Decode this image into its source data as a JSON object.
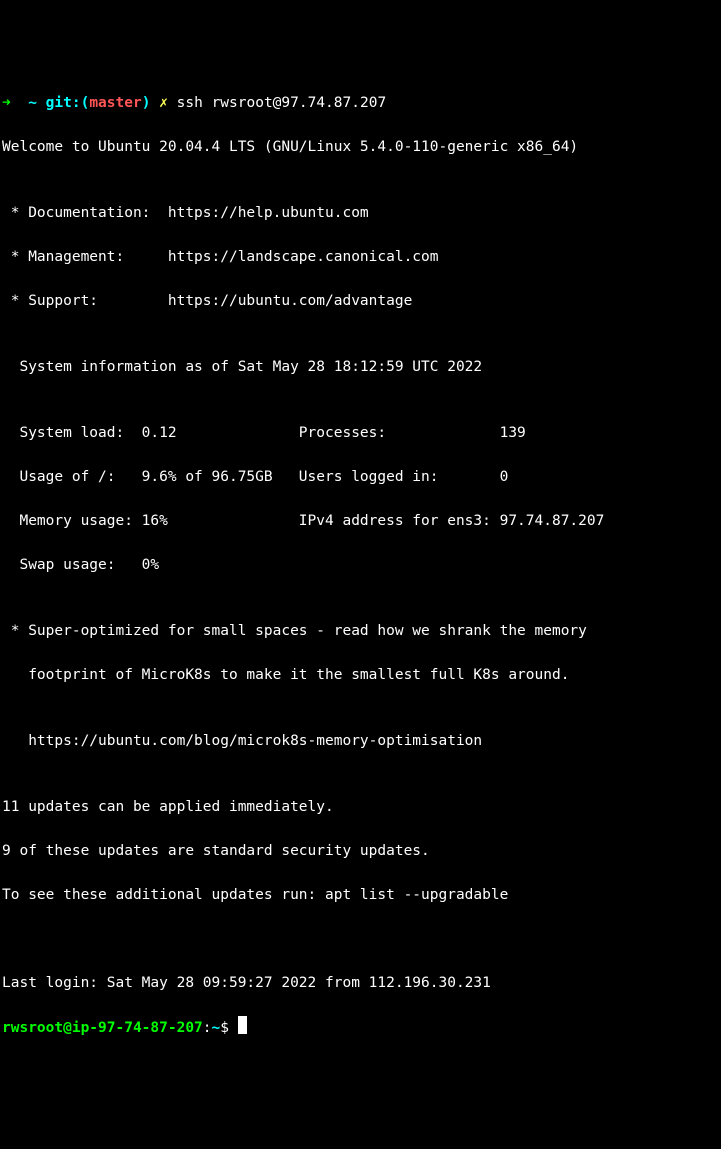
{
  "prompt1": {
    "arrow": "➜  ",
    "tilde": "~ ",
    "git_label": "git:(",
    "branch": "master",
    "git_close": ") ",
    "dirty": "✗ ",
    "cmd": "ssh rwsroot@97.74.87.207"
  },
  "motd": {
    "welcome": "Welcome to Ubuntu 20.04.4 LTS (GNU/Linux 5.4.0-110-generic x86_64)",
    "blank1": "",
    "doc": " * Documentation:  https://help.ubuntu.com",
    "mgmt": " * Management:     https://landscape.canonical.com",
    "support": " * Support:        https://ubuntu.com/advantage",
    "blank2": "",
    "sysinfo_header": "  System information as of Sat May 28 18:12:59 UTC 2022",
    "blank3": "",
    "row1": "  System load:  0.12              Processes:             139",
    "row2": "  Usage of /:   9.6% of 96.75GB   Users logged in:       0",
    "row3": "  Memory usage: 16%               IPv4 address for ens3: 97.74.87.207",
    "row4": "  Swap usage:   0%",
    "blank4": "",
    "promo1": " * Super-optimized for small spaces - read how we shrank the memory",
    "promo2": "   footprint of MicroK8s to make it the smallest full K8s around.",
    "blank5": "",
    "promo_url": "   https://ubuntu.com/blog/microk8s-memory-optimisation",
    "blank6": "",
    "updates1": "11 updates can be applied immediately.",
    "updates2": "9 of these updates are standard security updates.",
    "updates3": "To see these additional updates run: apt list --upgradable",
    "blank7": "",
    "blank8": "",
    "last_login": "Last login: Sat May 28 09:59:27 2022 from 112.196.30.231"
  },
  "prompt2": {
    "user_host": "rwsroot@ip-97-74-87-207",
    "colon": ":",
    "path": "~",
    "dollar": "$ "
  }
}
